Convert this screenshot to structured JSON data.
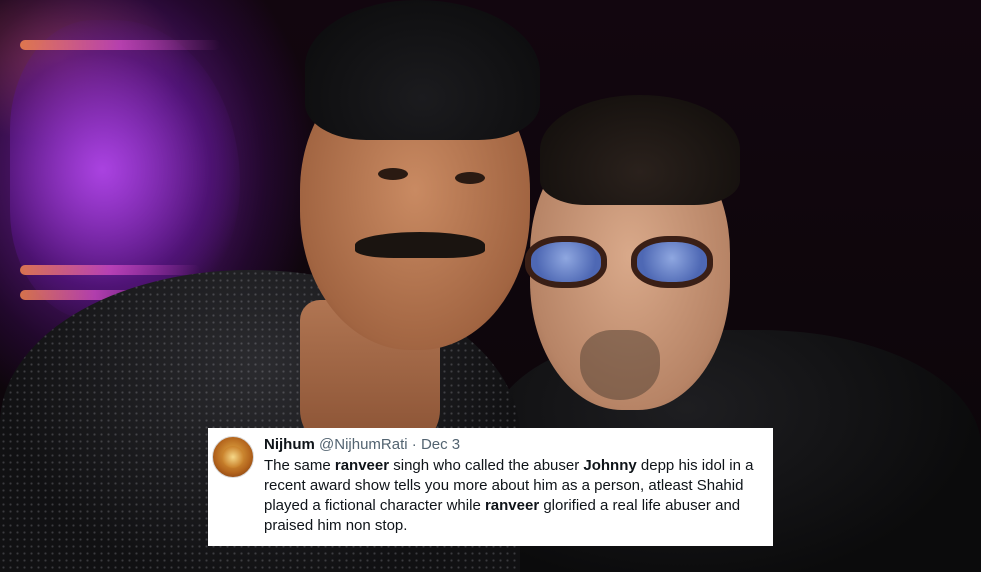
{
  "tweet": {
    "display_name": "Nijhum",
    "handle": "@NijhumRati",
    "separator": "·",
    "date": "Dec 3",
    "body": [
      {
        "t": "The same ",
        "b": false
      },
      {
        "t": "ranveer",
        "b": true
      },
      {
        "t": " singh who called the abuser ",
        "b": false
      },
      {
        "t": "Johnny",
        "b": true
      },
      {
        "t": " depp his idol in a recent award show tells you more about him as a person, atleast Shahid played a fictional character while ",
        "b": false
      },
      {
        "t": "ranveer",
        "b": true
      },
      {
        "t": " glorified a real life abuser and praised him non stop.",
        "b": false
      }
    ]
  }
}
